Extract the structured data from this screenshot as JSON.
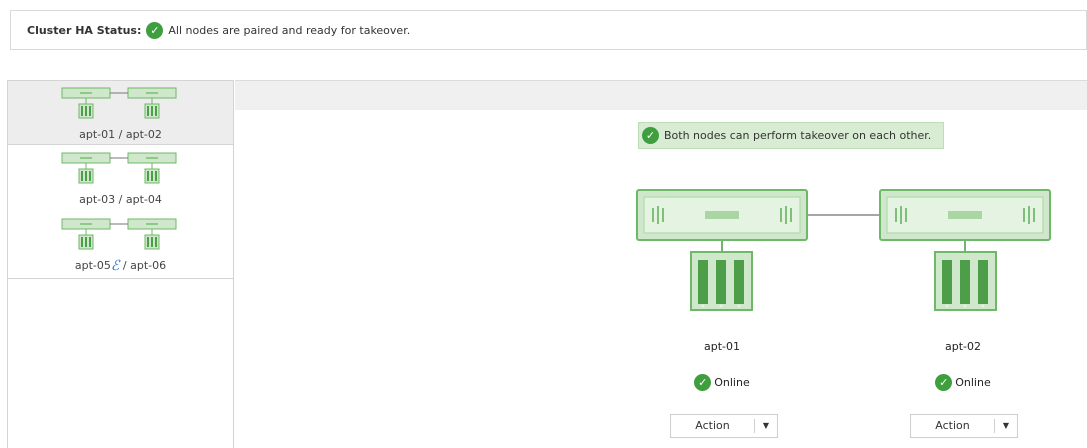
{
  "cluster_status": {
    "label": "Cluster HA Status:",
    "message": "All nodes are paired and ready for takeover."
  },
  "pairs": [
    {
      "name": "apt-01 / apt-02",
      "selected": true
    },
    {
      "name": "apt-03 / apt-04",
      "selected": false
    },
    {
      "name_left": "apt-05",
      "name_right": " / apt-06",
      "selected": false
    }
  ],
  "takeover": {
    "message": "Both nodes can perform takeover on each other."
  },
  "nodes": [
    {
      "name": "apt-01",
      "status": "Online",
      "action_label": "Action"
    },
    {
      "name": "apt-02",
      "status": "Online",
      "action_label": "Action"
    }
  ],
  "colors": {
    "online_green": "#3f9f3f",
    "node_fill": "#cfe8cb",
    "node_border": "#6fb86a",
    "message_bg": "#d7ecd3"
  }
}
